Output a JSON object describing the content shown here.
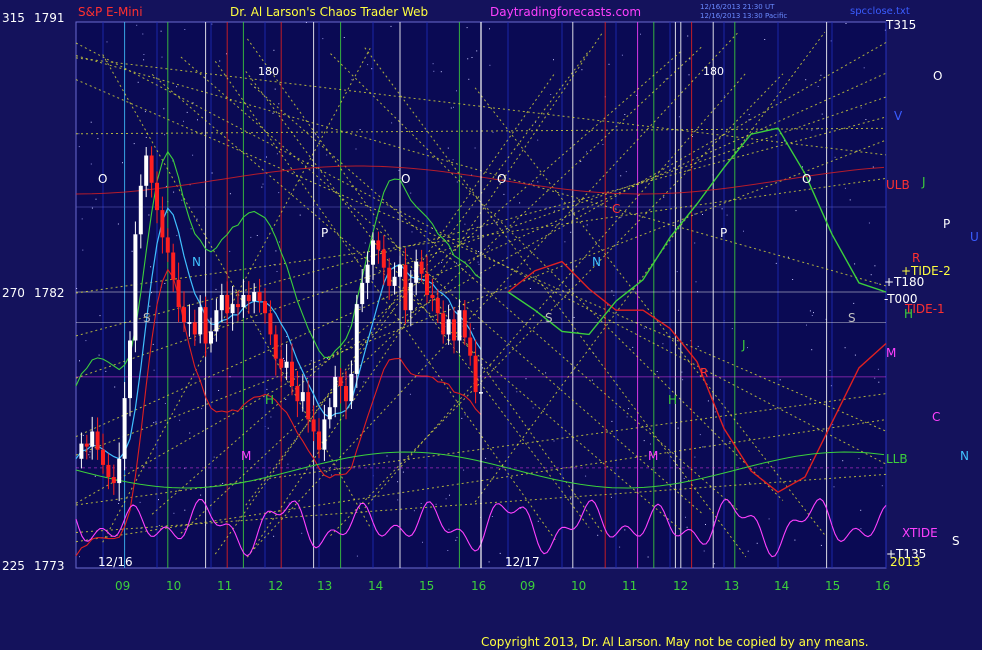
{
  "header": {
    "instrument": "S&P E-Mini",
    "title": "Dr. Al Larson's Chaos Trader Web",
    "site": "Daytradingforecasts.com",
    "timestamp_line1": "12/16/2013 21:30 UT",
    "timestamp_line2": "12/16/2013 13:30 Pacific",
    "program": "spcclose.txt"
  },
  "footer": {
    "copyright": "Copyright 2013, Dr. Al Larson. May not be copied by any means."
  },
  "y_axis_labels": [
    {
      "angle": "315",
      "price": "1791"
    },
    {
      "angle": "270",
      "price": "1782"
    },
    {
      "angle": "225",
      "price": "1773"
    }
  ],
  "day_markers": [
    "12/16",
    "12/17"
  ],
  "hour_labels": [
    "09",
    "10",
    "11",
    "12",
    "13",
    "14",
    "15",
    "16",
    "09",
    "10",
    "11",
    "12",
    "13",
    "14",
    "15",
    "16"
  ],
  "degree_markers": [
    "180",
    "180"
  ],
  "right_lines": [
    {
      "text": "T315",
      "color": "#ffffff"
    },
    {
      "text": "V",
      "color": "#3a5cff"
    },
    {
      "text": "ULB",
      "color": "#ff3030"
    },
    {
      "text": "+TIDE-2",
      "color": "#ffff40"
    },
    {
      "text": "+T180",
      "color": "#ffffff"
    },
    {
      "text": "-T000",
      "color": "#ffffff"
    },
    {
      "text": "TIDE-1",
      "color": "#ff3030"
    },
    {
      "text": "H",
      "color": "#3cd03c"
    },
    {
      "text": "M",
      "color": "#ff40ff"
    },
    {
      "text": "LLB",
      "color": "#3cd03c"
    },
    {
      "text": "XTIDE",
      "color": "#ff40ff"
    },
    {
      "text": "+T135",
      "color": "#ffffff"
    },
    {
      "text": "2013",
      "color": "#ffff40"
    }
  ],
  "planet_glyphs": [
    {
      "text": "O",
      "color": "#ffffff"
    },
    {
      "text": "J",
      "color": "#3cd03c"
    },
    {
      "text": "P",
      "color": "#ffffff"
    },
    {
      "text": "U",
      "color": "#3a5cff"
    },
    {
      "text": "R",
      "color": "#ff3030"
    },
    {
      "text": "C",
      "color": "#ff40ff"
    },
    {
      "text": "N",
      "color": "#40c0ff"
    },
    {
      "text": "S",
      "color": "#ffffff"
    }
  ],
  "chart_letters": [
    {
      "text": "O",
      "color": "#ffffff"
    },
    {
      "text": "O",
      "color": "#ffffff"
    },
    {
      "text": "O",
      "color": "#ffffff"
    },
    {
      "text": "O",
      "color": "#ffffff"
    },
    {
      "text": "P",
      "color": "#ffffff"
    },
    {
      "text": "P",
      "color": "#ffffff"
    },
    {
      "text": "N",
      "color": "#40c0ff"
    },
    {
      "text": "N",
      "color": "#40c0ff"
    },
    {
      "text": "S",
      "color": "#c0c0c0"
    },
    {
      "text": "S",
      "color": "#c0c0c0"
    },
    {
      "text": "S",
      "color": "#c0c0c0"
    },
    {
      "text": "H",
      "color": "#3cd03c"
    },
    {
      "text": "H",
      "color": "#3cd03c"
    },
    {
      "text": "M",
      "color": "#ff40ff"
    },
    {
      "text": "M",
      "color": "#ff40ff"
    },
    {
      "text": "J",
      "color": "#3cd03c"
    },
    {
      "text": "C",
      "color": "#ff3030"
    },
    {
      "text": "R",
      "color": "#ff3030"
    }
  ],
  "colors": {
    "background": "#14125c",
    "grid_yellow": "#e8e838",
    "price_up": "#ffffff",
    "price_down": "#ff2020",
    "tide_green": "#3cd03c",
    "ulb_red": "#e02020",
    "avg_cyan": "#40c0ff",
    "xtide_magenta": "#ff40ff",
    "copyright": "#ffff40"
  },
  "chart_data": {
    "type": "candlestick",
    "instrument": "S&P E-Mini",
    "x_axis_hour_ticks": [
      "09",
      "10",
      "11",
      "12",
      "13",
      "14",
      "15",
      "16",
      "09",
      "10",
      "11",
      "12",
      "13",
      "14",
      "15",
      "16"
    ],
    "y_price_labels": [
      1791,
      1782,
      1773
    ],
    "ylim": [
      1773,
      1791
    ],
    "price_path_12_16": [
      [
        8.5,
        1776.6
      ],
      [
        8.6,
        1777.1
      ],
      [
        8.7,
        1777.0
      ],
      [
        8.8,
        1777.5
      ],
      [
        8.9,
        1776.9
      ],
      [
        9.0,
        1776.4
      ],
      [
        9.1,
        1776.0
      ],
      [
        9.2,
        1775.8
      ],
      [
        9.3,
        1776.6
      ],
      [
        9.4,
        1778.6
      ],
      [
        9.5,
        1780.5
      ],
      [
        9.6,
        1784.0
      ],
      [
        9.7,
        1785.6
      ],
      [
        9.8,
        1786.6
      ],
      [
        9.9,
        1785.7
      ],
      [
        10.0,
        1784.8
      ],
      [
        10.1,
        1783.9
      ],
      [
        10.2,
        1783.4
      ],
      [
        10.3,
        1782.5
      ],
      [
        10.4,
        1781.6
      ],
      [
        10.5,
        1781.1
      ],
      [
        10.6,
        1781.1
      ],
      [
        10.7,
        1780.7
      ],
      [
        10.8,
        1781.6
      ],
      [
        10.9,
        1780.4
      ],
      [
        11.0,
        1780.8
      ],
      [
        11.1,
        1781.5
      ],
      [
        11.2,
        1782.0
      ],
      [
        11.3,
        1781.4
      ],
      [
        11.4,
        1781.7
      ],
      [
        11.5,
        1781.6
      ],
      [
        11.6,
        1782.0
      ],
      [
        11.7,
        1781.8
      ],
      [
        11.8,
        1782.1
      ],
      [
        11.9,
        1781.8
      ],
      [
        12.0,
        1781.4
      ],
      [
        12.1,
        1780.7
      ],
      [
        12.2,
        1779.9
      ],
      [
        12.3,
        1779.6
      ],
      [
        12.4,
        1779.8
      ],
      [
        12.5,
        1779.0
      ],
      [
        12.6,
        1778.5
      ],
      [
        12.7,
        1778.8
      ],
      [
        12.8,
        1777.9
      ],
      [
        12.9,
        1777.5
      ],
      [
        13.0,
        1776.9
      ],
      [
        13.1,
        1777.9
      ],
      [
        13.2,
        1778.3
      ],
      [
        13.3,
        1779.3
      ],
      [
        13.4,
        1779.0
      ],
      [
        13.5,
        1778.5
      ],
      [
        13.6,
        1779.4
      ],
      [
        13.7,
        1781.7
      ],
      [
        13.8,
        1782.4
      ],
      [
        13.9,
        1783.0
      ],
      [
        14.0,
        1783.8
      ],
      [
        14.1,
        1783.5
      ],
      [
        14.2,
        1782.9
      ],
      [
        14.3,
        1782.3
      ],
      [
        14.4,
        1782.6
      ],
      [
        14.5,
        1783.0
      ],
      [
        14.6,
        1781.5
      ],
      [
        14.7,
        1782.4
      ],
      [
        14.8,
        1783.1
      ],
      [
        14.9,
        1782.7
      ],
      [
        15.0,
        1782.0
      ],
      [
        15.1,
        1781.9
      ],
      [
        15.2,
        1781.4
      ],
      [
        15.3,
        1780.7
      ],
      [
        15.4,
        1781.2
      ],
      [
        15.5,
        1780.5
      ],
      [
        15.6,
        1781.5
      ],
      [
        15.7,
        1780.6
      ],
      [
        15.8,
        1780.0
      ],
      [
        15.9,
        1778.8
      ],
      [
        16.0,
        1778.8
      ]
    ],
    "series": [
      {
        "name": "TIDE-1",
        "day": "12/17",
        "points": [
          [
            9.0,
            1782.1
          ],
          [
            9.5,
            1782.8
          ],
          [
            10.0,
            1783.1
          ],
          [
            10.5,
            1782.2
          ],
          [
            11.0,
            1781.5
          ],
          [
            11.5,
            1781.5
          ],
          [
            12.0,
            1780.9
          ],
          [
            12.5,
            1779.8
          ],
          [
            13.0,
            1777.6
          ],
          [
            13.5,
            1776.2
          ],
          [
            14.0,
            1775.5
          ],
          [
            14.5,
            1776.0
          ],
          [
            15.0,
            1777.8
          ],
          [
            15.5,
            1779.6
          ],
          [
            16.0,
            1780.4
          ]
        ]
      },
      {
        "name": "TIDE-2",
        "day": "12/17",
        "points": [
          [
            9.0,
            1782.1
          ],
          [
            9.5,
            1781.5
          ],
          [
            10.0,
            1780.8
          ],
          [
            10.5,
            1780.7
          ],
          [
            11.0,
            1781.8
          ],
          [
            11.5,
            1782.5
          ],
          [
            12.0,
            1783.9
          ],
          [
            12.5,
            1785.0
          ],
          [
            13.0,
            1786.2
          ],
          [
            13.5,
            1787.3
          ],
          [
            14.0,
            1787.5
          ],
          [
            14.5,
            1786.0
          ],
          [
            15.0,
            1784.0
          ],
          [
            15.5,
            1782.4
          ],
          [
            16.0,
            1782.1
          ]
        ]
      }
    ]
  }
}
